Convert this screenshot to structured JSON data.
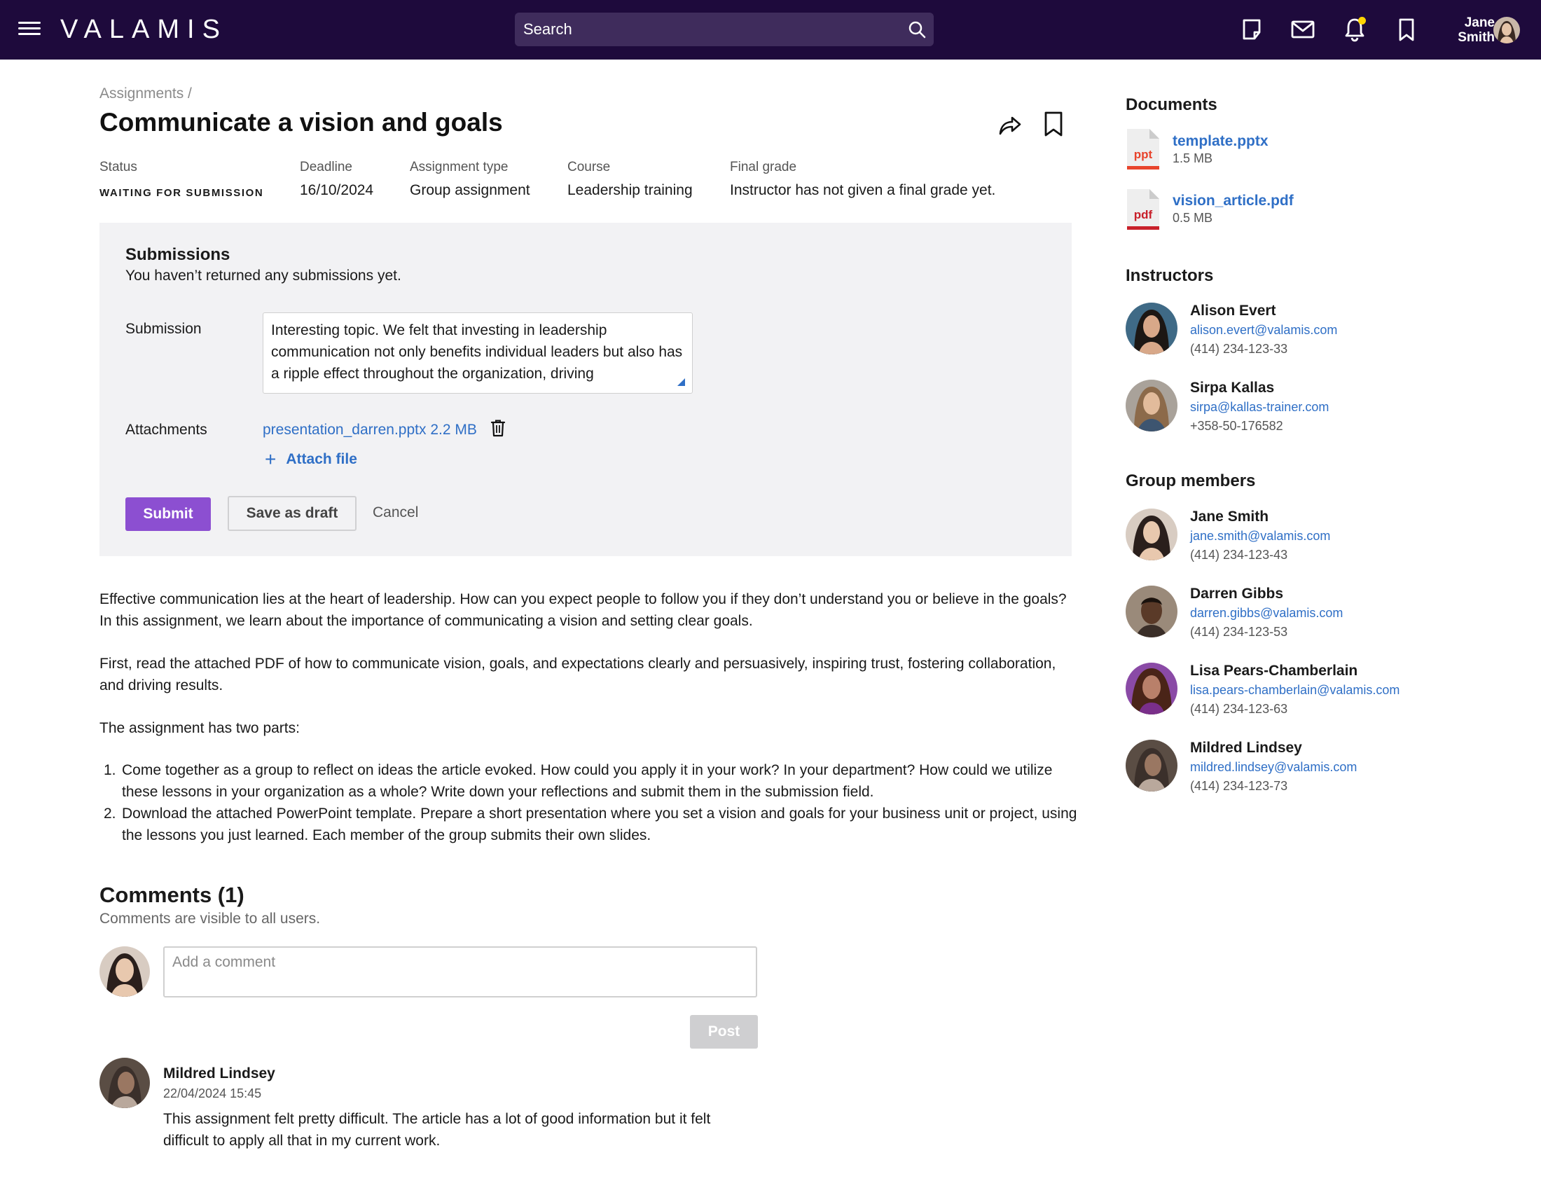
{
  "header": {
    "logo": "VALAMIS",
    "search_placeholder": "Search",
    "user_name_first": "Jane",
    "user_name_last": "Smith"
  },
  "page": {
    "breadcrumb": "Assignments /",
    "title": "Communicate a vision and goals"
  },
  "meta": {
    "status_label": "Status",
    "status_value": "WAITING FOR SUBMISSION",
    "deadline_label": "Deadline",
    "deadline_value": "16/10/2024",
    "type_label": "Assignment type",
    "type_value": "Group assignment",
    "course_label": "Course",
    "course_value": "Leadership training",
    "grade_label": "Final grade",
    "grade_value": "Instructor has not given a final grade yet."
  },
  "submissions": {
    "title": "Submissions",
    "subtitle": "You haven’t returned any submissions yet.",
    "submission_label": "Submission",
    "submission_text": "Interesting topic. We felt that investing in leadership communication not only benefits individual leaders but also has a ripple effect throughout the organization, driving",
    "attachments_label": "Attachments",
    "attachment_file": "presentation_darren.pptx 2.2 MB",
    "attach_file_label": "Attach file",
    "submit_label": "Submit",
    "draft_label": "Save as draft",
    "cancel_label": "Cancel"
  },
  "description": {
    "p1": "Effective communication lies at the heart of leadership. How can you expect people to follow you if they don’t understand you or believe in the goals? In this assignment, we learn about the importance of communicating a vision and setting clear goals.",
    "p2": "First, read the attached PDF of how to communicate vision, goals, and expectations clearly and persuasively, inspiring trust, fostering collaboration, and driving results.",
    "p3": "The assignment has two parts:",
    "items": [
      "Come together as a group to reflect on ideas the article evoked. How could you apply it in your work? In your department? How could we utilize these lessons in your organization as a whole? Write down your reflections and submit them in the submission field.",
      "Download the attached PowerPoint template. Prepare a short presentation where you set a vision and goals for your business unit or project, using the lessons you just learned. Each member of the group submits their own slides."
    ]
  },
  "comments": {
    "title": "Comments (1)",
    "subtitle": "Comments are visible to all users.",
    "input_placeholder": "Add a comment",
    "post_label": "Post",
    "items": [
      {
        "author": "Mildred Lindsey",
        "date": "22/04/2024 15:45",
        "text": "This assignment felt pretty difficult. The article has a lot of good information but it felt difficult to apply all that in my current work."
      }
    ]
  },
  "documents": {
    "title": "Documents",
    "items": [
      {
        "name": "template.pptx",
        "size": "1.5 MB",
        "ext": "ppt",
        "color": "#e8442c"
      },
      {
        "name": "vision_article.pdf",
        "size": "0.5 MB",
        "ext": "pdf",
        "color": "#c8202a"
      }
    ]
  },
  "instructors": {
    "title": "Instructors",
    "items": [
      {
        "name": "Alison Evert",
        "email": "alison.evert@valamis.com",
        "phone": "(414) 234-123-33"
      },
      {
        "name": "Sirpa Kallas",
        "email": "sirpa@kallas-trainer.com",
        "phone": "+358-50-176582"
      }
    ]
  },
  "group_members": {
    "title": "Group members",
    "items": [
      {
        "name": "Jane Smith",
        "email": "jane.smith@valamis.com",
        "phone": "(414) 234-123-43"
      },
      {
        "name": "Darren Gibbs",
        "email": "darren.gibbs@valamis.com",
        "phone": "(414) 234-123-53"
      },
      {
        "name": "Lisa Pears-Chamberlain",
        "email": "lisa.pears-chamberlain@valamis.com",
        "phone": "(414) 234-123-63"
      },
      {
        "name": "Mildred Lindsey",
        "email": "mildred.lindsey@valamis.com",
        "phone": "(414) 234-123-73"
      }
    ]
  },
  "colors": {
    "topbar": "#1e0a3c",
    "accent_purple": "#8c4fd1",
    "link_blue": "#2f6fc6",
    "notification_dot": "#ffd400"
  },
  "icons": [
    "menu-icon",
    "search-icon",
    "notes-icon",
    "mail-icon",
    "bell-icon",
    "bookmark-icon",
    "share-icon",
    "trash-icon",
    "plus-icon",
    "ppt-file-icon",
    "pdf-file-icon"
  ]
}
